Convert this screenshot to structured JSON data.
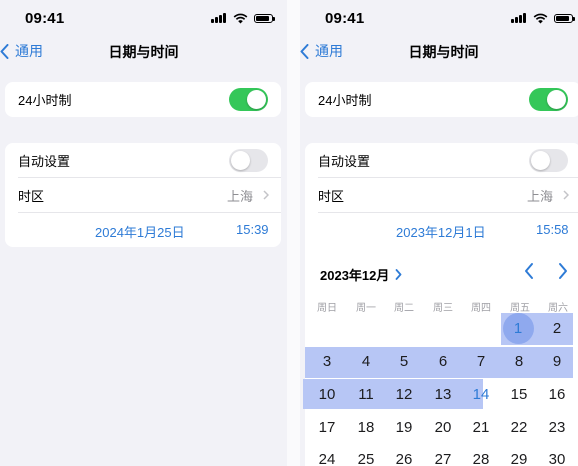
{
  "status_bar": {
    "time": "09:41"
  },
  "nav": {
    "back_label": "通用",
    "title": "日期与时间"
  },
  "settings": {
    "hour24_label": "24小时制",
    "hour24_on": true,
    "auto_label": "自动设置",
    "auto_on": false,
    "timezone_label": "时区",
    "timezone_value": "上海"
  },
  "left": {
    "date": "2024年1月25日",
    "time": "15:39"
  },
  "right": {
    "date": "2023年12月1日",
    "time": "15:58"
  },
  "calendar": {
    "month_label": "2023年12月",
    "weekdays": [
      "周日",
      "周一",
      "周二",
      "周三",
      "周四",
      "周五",
      "周六"
    ],
    "selected_day": "1",
    "today_day": "14",
    "week1": [
      "1",
      "2"
    ],
    "week2": [
      "3",
      "4",
      "5",
      "6",
      "7",
      "8",
      "9"
    ],
    "week3": [
      "10",
      "11",
      "12",
      "13",
      "14",
      "15",
      "16"
    ],
    "week4": [
      "17",
      "18",
      "19",
      "20",
      "21",
      "22",
      "23"
    ],
    "week5": [
      "24",
      "25",
      "26",
      "27",
      "28",
      "29",
      "30"
    ]
  },
  "colors": {
    "accent": "#2e7bd6",
    "toggle_on": "#34c759",
    "highlight": "#b7c6f5"
  }
}
